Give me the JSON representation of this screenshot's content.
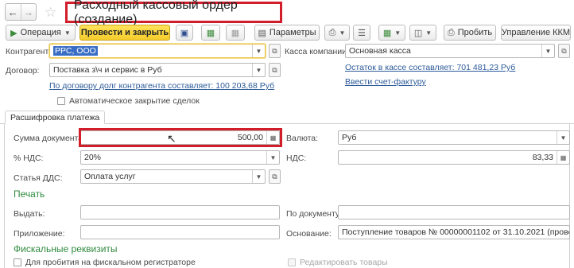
{
  "window": {
    "title": "Расходный кассовый ордер (создание)"
  },
  "toolbar": {
    "operation_label": "Операция",
    "post_close_label": "Провести и закрыть",
    "params_label": "Параметры",
    "punch_label": "Пробить",
    "kkm_label": "Управление ККМ"
  },
  "form": {
    "contragent_label": "Контрагент:",
    "contragent_value": "РРС, ООО",
    "contract_label": "Договор:",
    "contract_value": "Поставка з\\ч и сервис в Руб",
    "debt_link": "По договору долг контрагента составляет: 100 203,68 Руб",
    "auto_close_label": "Автоматическое закрытие сделок",
    "cashbox_label": "Касса компании:",
    "cashbox_value": "Основная касса",
    "balance_link": "Остаток в кассе составляет: 701 481,23 Руб",
    "invoice_link": "Ввести счет-фактуру"
  },
  "tabs": [
    "Расшифровка платежа"
  ],
  "payment": {
    "amount_label": "Сумма документа:",
    "amount_value": "500,00",
    "vat_rate_label": "% НДС:",
    "vat_rate_value": "20%",
    "dds_label": "Статья ДДС:",
    "dds_value": "Оплата услуг",
    "currency_label": "Валюта:",
    "currency_value": "Руб",
    "vat_label": "НДС:",
    "vat_value": "83,33"
  },
  "print": {
    "section_title": "Печать",
    "issue_label": "Выдать:",
    "issue_value": "",
    "by_doc_label": "По документу:",
    "by_doc_value": "",
    "attachment_label": "Приложение:",
    "attachment_value": "",
    "basis_label": "Основание:",
    "basis_value": "Поступление товаров № 00000001102 от 31.10.2021 (проведен)"
  },
  "fiscal": {
    "section_title": "Фискальные реквизиты",
    "punch_register_label": "Для пробития на фискальном регистраторе",
    "edit_goods_label": "Редактировать товары"
  },
  "colors": {
    "highlight_red": "#d21e2b",
    "primary_yellow": "#f5cc2b",
    "link_blue": "#2c5a99",
    "section_green": "#2f8a3e"
  }
}
